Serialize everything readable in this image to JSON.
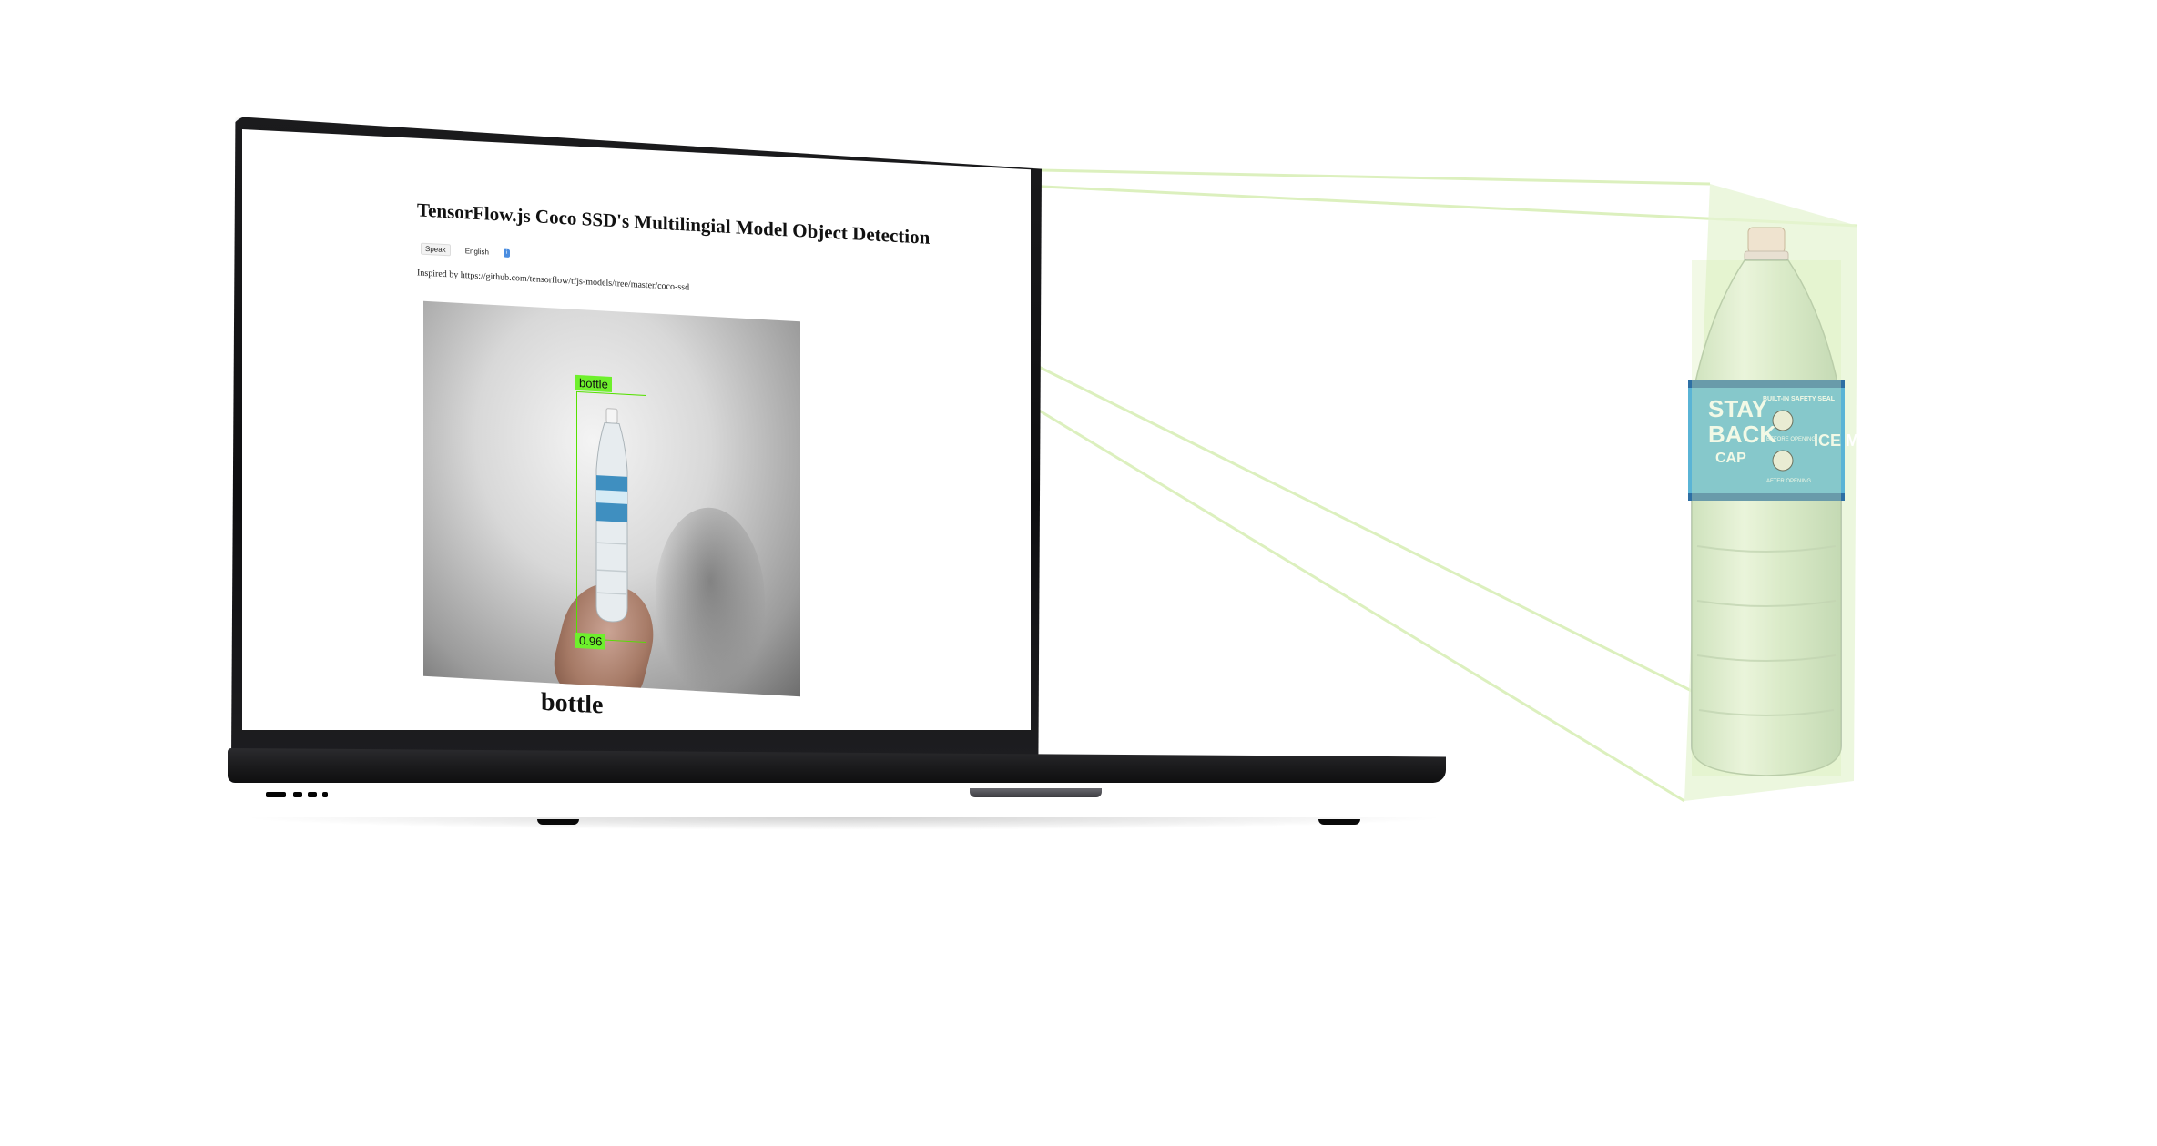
{
  "app": {
    "page_title": "TensorFlow.js Coco SSD's Multilingial Model Object Detection",
    "controls": {
      "speak_button": "Speak",
      "language_select": "English",
      "info_icon": "info-icon"
    },
    "inspired_text": "Inspired by https://github.com/tensorflow/tfjs-models/tree/master/coco-ssd"
  },
  "detection": {
    "label": "bottle",
    "score": "0.96",
    "box_color": "#55e000",
    "label_bg": "#6ef02c"
  },
  "result": {
    "detected_class": "bottle"
  },
  "bottle_label": {
    "line1": "STAY",
    "line2": "BACK",
    "line3": "CAP",
    "badge_top": "BUILT-IN SAFETY SEAL",
    "badge_mid": "BEFORE OPENING",
    "badge_bottom": "AFTER OPENING",
    "brand": "ICE M"
  },
  "colors": {
    "projection": "#d9efb8",
    "bottle_tint": "#e8f5d6",
    "label_blue": "#5ab4d6"
  }
}
